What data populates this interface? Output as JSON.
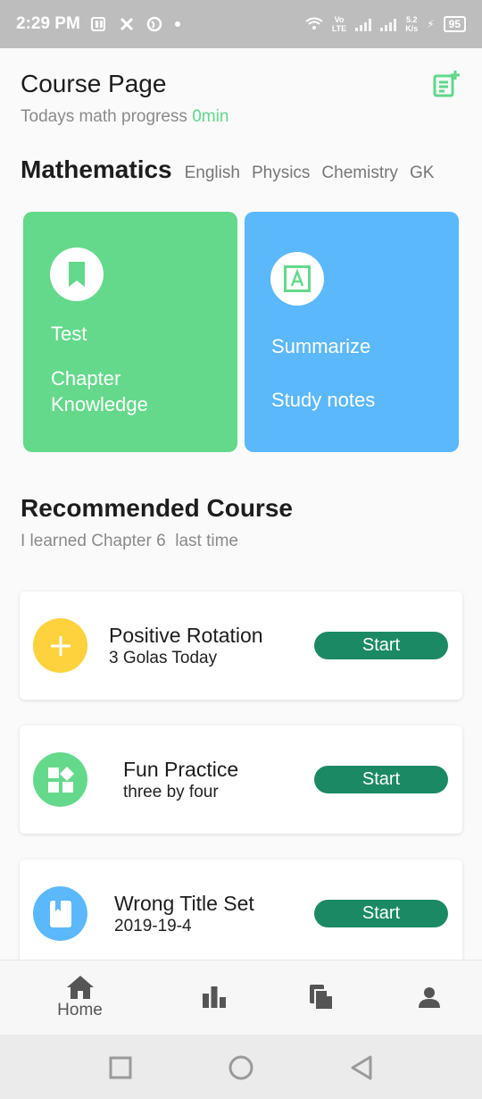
{
  "status_bar": {
    "time": "2:29 PM",
    "network_label_top": "Vo",
    "network_label_bottom": "LTE",
    "speed_value": "5.2",
    "speed_unit": "K/s",
    "battery": "95"
  },
  "header": {
    "title": "Course Page",
    "progress_label": "Todays math progress",
    "progress_value": "0min"
  },
  "subjects": {
    "active": "Mathematics",
    "tabs": [
      "English",
      "Physics",
      "Chemistry",
      "GK"
    ]
  },
  "cards": {
    "green": {
      "line1": "Test",
      "line2a": "Chapter",
      "line2b": "Knowledge",
      "color": "#64d98b"
    },
    "blue": {
      "line1": "Summarize",
      "line2": "Study notes",
      "color": "#5bb8fb"
    }
  },
  "recommended": {
    "title": "Recommended Course",
    "subtitle": "I learned Chapter 6  last time",
    "courses": [
      {
        "title": "Positive Rotation",
        "subtitle": "3 Golas Today",
        "button": "Start",
        "icon": "plus-icon",
        "icon_color": "#fdd23c"
      },
      {
        "title": "Fun Practice",
        "subtitle": "three by four",
        "button": "Start",
        "icon": "widgets-icon",
        "icon_color": "#64d98b"
      },
      {
        "title": "Wrong Title Set",
        "subtitle": "2019-19-4",
        "button": "Start",
        "icon": "book-icon",
        "icon_color": "#5bb8fb"
      }
    ]
  },
  "bottom_nav": {
    "items": [
      {
        "label": "Home",
        "icon": "home-icon"
      },
      {
        "label": "",
        "icon": "bar-chart-icon"
      },
      {
        "label": "",
        "icon": "documents-icon"
      },
      {
        "label": "",
        "icon": "person-icon"
      }
    ]
  },
  "colors": {
    "accent_green": "#64d98b",
    "accent_blue": "#5bb8fb",
    "button_green": "#1b8a64"
  }
}
